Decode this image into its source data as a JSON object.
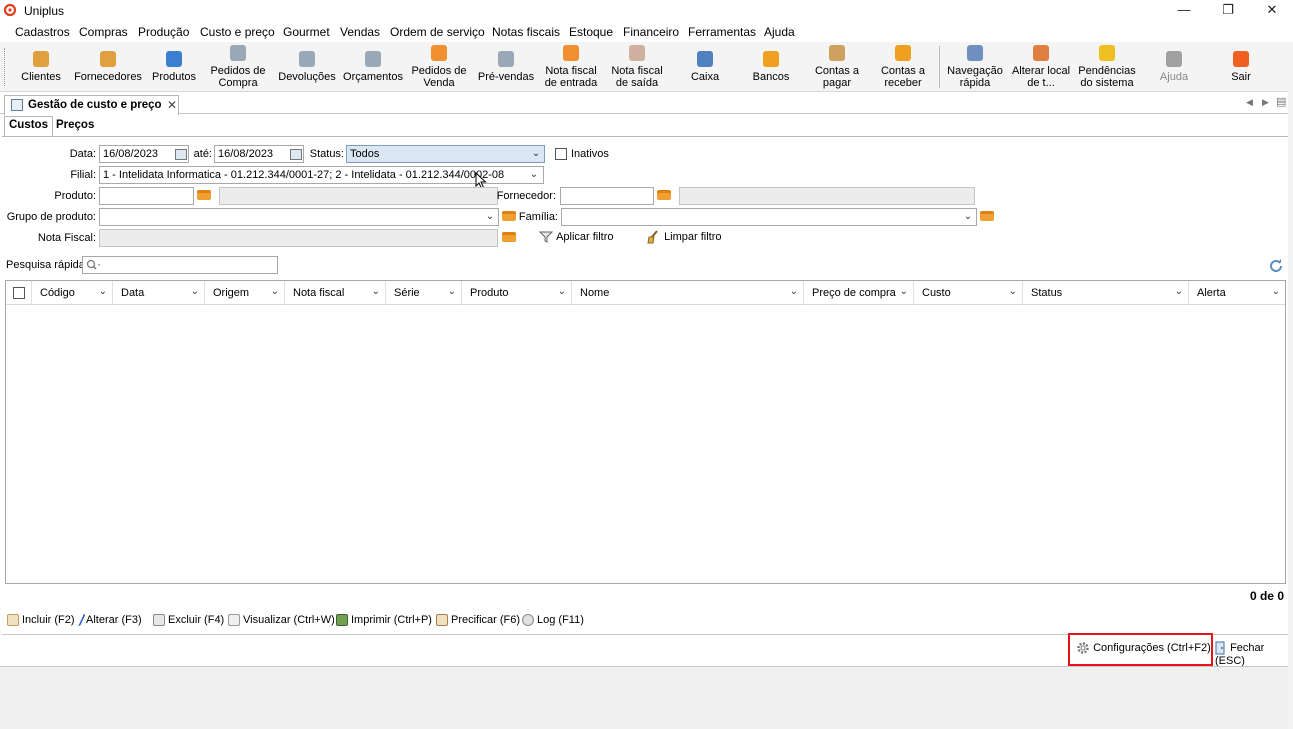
{
  "window": {
    "title": "Uniplus",
    "controls": {
      "minimize": "—",
      "restore": "❐",
      "close": "✕"
    }
  },
  "menu": [
    "Cadastros",
    "Compras",
    "Produção",
    "Custo e preço",
    "Gourmet",
    "Vendas",
    "Ordem de serviço",
    "Notas fiscais",
    "Estoque",
    "Financeiro",
    "Ferramentas",
    "Ajuda"
  ],
  "toolbar": [
    {
      "label1": "",
      "label2": "Clientes",
      "icon": "person-icon",
      "color": "#e0a040"
    },
    {
      "label1": "",
      "label2": "Fornecedores",
      "icon": "supplier-icon",
      "color": "#e0a040"
    },
    {
      "label1": "",
      "label2": "Produtos",
      "icon": "product-icon",
      "color": "#3c7fd0"
    },
    {
      "label1": "Pedidos de",
      "label2": "Compra",
      "icon": "purchase-order-icon",
      "color": "#9aa8b8"
    },
    {
      "label1": "",
      "label2": "Devoluções",
      "icon": "returns-icon",
      "color": "#9aa8b8"
    },
    {
      "label1": "",
      "label2": "Orçamentos",
      "icon": "quote-icon",
      "color": "#9aa8b8"
    },
    {
      "label1": "Pedidos de",
      "label2": "Venda",
      "icon": "sales-order-icon",
      "color": "#f09030"
    },
    {
      "label1": "",
      "label2": "Pré-vendas",
      "icon": "cart-icon",
      "color": "#9aa8b8"
    },
    {
      "label1": "Nota fiscal",
      "label2": "de entrada",
      "icon": "invoice-in-icon",
      "color": "#f09030"
    },
    {
      "label1": "Nota fiscal",
      "label2": "de saída",
      "icon": "invoice-out-icon",
      "color": "#d0b0a0"
    },
    {
      "label1": "",
      "label2": "Caixa",
      "icon": "cash-icon",
      "color": "#5080c0"
    },
    {
      "label1": "",
      "label2": "Bancos",
      "icon": "piggy-bank-icon",
      "color": "#f0a020"
    },
    {
      "label1": "Contas a",
      "label2": "pagar",
      "icon": "bill-pay-icon",
      "color": "#d0a060"
    },
    {
      "label1": "Contas a",
      "label2": "receber",
      "icon": "coins-icon",
      "color": "#f0a020"
    },
    {
      "label1": "Navegação",
      "label2": "rápida",
      "icon": "quick-nav-icon",
      "color": "#7090c0"
    },
    {
      "label1": "Alterar local",
      "label2": "de t...",
      "icon": "home-icon",
      "color": "#e08040"
    },
    {
      "label1": "Pendências",
      "label2": "do sistema",
      "icon": "warning-icon",
      "color": "#f0c020"
    },
    {
      "label1": "",
      "label2": "Ajuda",
      "icon": "help-icon",
      "color": "#a0a0a0"
    },
    {
      "label1": "",
      "label2": "Sair",
      "icon": "power-icon",
      "color": "#f06020"
    }
  ],
  "doc_tab": {
    "title": "Gestão de custo e preço",
    "close": "✕"
  },
  "nav_arrows": {
    "left": "◀",
    "right": "▶",
    "menu": "▤"
  },
  "sub_tabs": [
    "Custos",
    "Preços"
  ],
  "filters": {
    "data_label": "Data:",
    "data_from": "16/08/2023",
    "ate_label": "até:",
    "data_to": "16/08/2023",
    "status_label": "Status:",
    "status_value": "Todos",
    "inativos_label": "Inativos",
    "filial_label": "Filial:",
    "filial_value": "1 - Intelidata Informatica - 01.212.344/0001-27; 2 - Intelidata - 01.212.344/0002-08",
    "produto_label": "Produto:",
    "fornecedor_label": "Fornecedor:",
    "grupo_label": "Grupo de produto:",
    "familia_label": "Família:",
    "nota_label": "Nota Fiscal:",
    "aplicar_filtro": "Aplicar filtro",
    "limpar_filtro": "Limpar filtro"
  },
  "quick_search": {
    "label": "Pesquisa rápida:"
  },
  "grid": {
    "columns": [
      "Código",
      "Data",
      "Origem",
      "Nota fiscal",
      "Série",
      "Produto",
      "Nome",
      "Preço de compra",
      "Custo",
      "Status",
      "Alerta"
    ],
    "count": "0 de 0"
  },
  "actions": [
    "Incluir (F2)",
    "Alterar (F3)",
    "Excluir (F4)",
    "Visualizar (Ctrl+W)",
    "Imprimir (Ctrl+P)",
    "Precificar (F6)",
    "Log (F11)"
  ],
  "footer": {
    "config": "Configurações (Ctrl+F2)",
    "close": "Fechar (ESC)"
  },
  "colors": {
    "highlight": "#e8141c",
    "status_field": "#dbe6f4"
  }
}
